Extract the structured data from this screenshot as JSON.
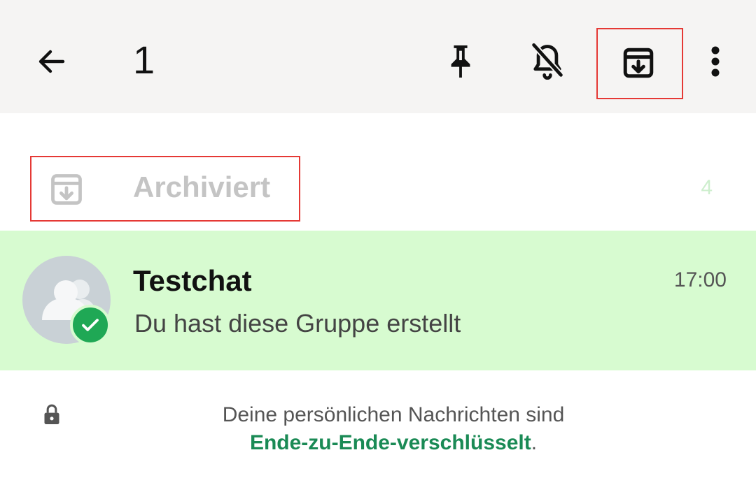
{
  "header": {
    "selected_count": "1",
    "icons": {
      "back": "arrow-left-icon",
      "pin": "pin-icon",
      "mute": "bell-off-icon",
      "archive": "archive-icon",
      "more": "more-vertical-icon"
    }
  },
  "archived": {
    "label": "Archiviert",
    "count": "4",
    "icon": "archive-icon"
  },
  "chat": {
    "name": "Testchat",
    "time": "17:00",
    "preview": "Du hast diese Gruppe erstellt",
    "avatar_icon": "group-icon",
    "badge_icon": "check-icon"
  },
  "footer": {
    "line1": "Deine persönlichen Nachrichten sind",
    "link": "Ende-zu-Ende-verschlüsselt",
    "period": ".",
    "icon": "lock-icon"
  },
  "colors": {
    "topbar_bg": "#f5f4f3",
    "selected_row_bg": "#d7fbd0",
    "accent_green": "#1fa855",
    "link_green": "#1a8a55",
    "highlight_red": "#e53935"
  }
}
